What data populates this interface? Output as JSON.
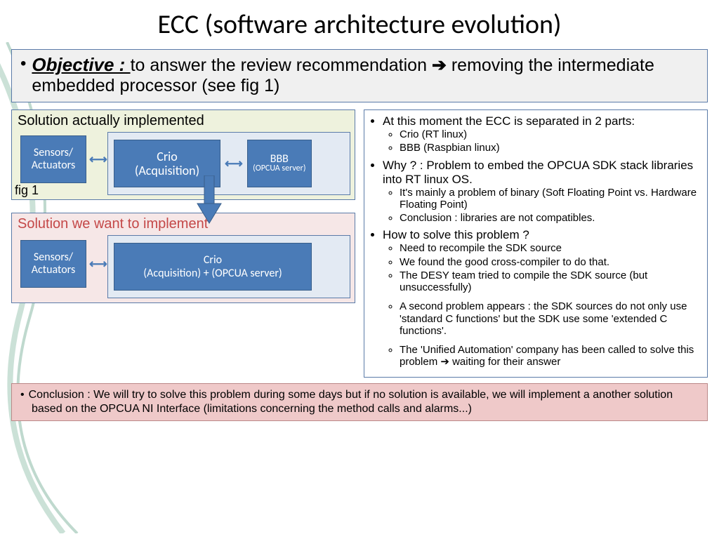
{
  "title": "ECC (software architecture evolution)",
  "objective": {
    "label": "Objective : ",
    "text_part1": "to answer the review recommendation ",
    "arrow": "➔",
    "text_part2": " removing the intermediate embedded processor (see fig 1)"
  },
  "panel_current": {
    "title": "Solution actually implemented",
    "sensors": "Sensors/ Actuators",
    "crio_l1": "Crio",
    "crio_l2": "(Acquisition)",
    "bbb_l1": "BBB",
    "bbb_l2": "(OPCUA server)",
    "fig": "fig 1"
  },
  "panel_target": {
    "title": "Solution we want to implement",
    "sensors": "Sensors/ Actuators",
    "crio_l1": "Crio",
    "crio_l2": "(Acquisition) + (OPCUA server)"
  },
  "right": {
    "b1": "At this moment the ECC is separated in 2 parts:",
    "b1_sub": [
      "Crio (RT linux)",
      "BBB (Raspbian linux)"
    ],
    "b2": "Why ? : Problem to embed the OPCUA SDK stack libraries into RT linux OS.",
    "b2_sub": [
      "It's mainly a problem of binary (Soft Floating Point vs. Hardware Floating Point)",
      "Conclusion : libraries are not compatibles."
    ],
    "b3": "How to solve this problem ?",
    "b3_sub": [
      "Need to recompile the SDK source",
      "We found the good cross-compiler to do that.",
      "The DESY team tried to compile the SDK source (but unsuccessfully)",
      "A second problem appears : the SDK sources do not only use  'standard C functions' but the SDK use some 'extended C functions'.",
      "The 'Unified Automation' company has been called to solve this problem ➔ waiting for their answer"
    ]
  },
  "conclusion": "Conclusion : We will try to solve this problem during some days but if no solution is available, we will implement a another solution based on the OPCUA NI Interface (limitations concerning the method calls and alarms...)"
}
